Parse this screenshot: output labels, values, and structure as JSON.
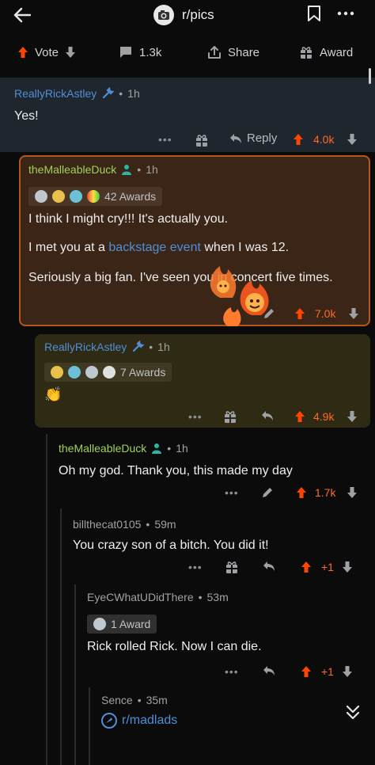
{
  "topbar": {
    "back_icon": "arrow-left-icon",
    "subreddit": "r/pics",
    "save_icon": "bookmark-icon",
    "more_icon": "more-horizontal-icon"
  },
  "actions": {
    "vote": "Vote",
    "comments": "1.3k",
    "share": "Share",
    "award": "Award"
  },
  "comments": [
    {
      "user": "ReallyRickAstley",
      "time": "1h",
      "text": "Yes!",
      "reply": "Reply",
      "score": "4.0k"
    },
    {
      "user": "theMalleableDuck",
      "time": "1h",
      "awards": "42 Awards",
      "text1": "I think I might cry!!! It's actually you.",
      "text2_before": "I met you at a ",
      "text2_link": "backstage event",
      "text2_after": " when I was 12.",
      "text3": "Seriously a big fan. I've seen you in concert five times.",
      "score": "7.0k"
    },
    {
      "user": "ReallyRickAstley",
      "time": "1h",
      "awards": "7 Awards",
      "text": "👏",
      "score": "4.9k"
    },
    {
      "user": "theMalleableDuck",
      "time": "1h",
      "text": "Oh my god. Thank you, this made my day",
      "score": "1.7k"
    },
    {
      "user": "billthecat0105",
      "time": "59m",
      "text": "You crazy son of a bitch. You did it!",
      "score": "+1"
    },
    {
      "user": "EyeCWhatUDidThere",
      "time": "53m",
      "awards": "1 Award",
      "text": "Rick rolled Rick. Now I can die.",
      "score": "+1"
    },
    {
      "user": "Sence",
      "time": "35m",
      "text": "r/madlads"
    }
  ],
  "colors": {
    "upvote": "#ff4500",
    "username": "#4f8fd8",
    "highlight_orange": "#ff7b2e",
    "highlight_yellow": "#f5d235"
  }
}
